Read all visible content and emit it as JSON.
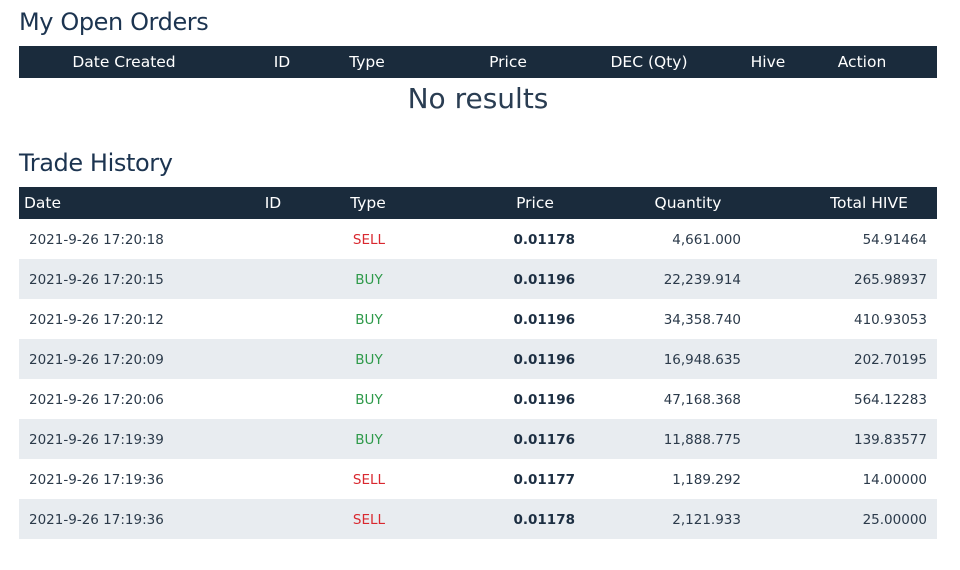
{
  "open_orders": {
    "title": "My Open Orders",
    "columns": [
      "Date Created",
      "ID",
      "Type",
      "Price",
      "DEC (Qty)",
      "Hive",
      "Action"
    ],
    "empty_message": "No results"
  },
  "trade_history": {
    "title": "Trade History",
    "columns": [
      "Date",
      "ID",
      "Type",
      "Price",
      "Quantity",
      "Total HIVE"
    ],
    "rows": [
      {
        "date": "2021-9-26 17:20:18",
        "type": "SELL",
        "price": "0.01178",
        "quantity": "4,661.000",
        "total": "54.91464"
      },
      {
        "date": "2021-9-26 17:20:15",
        "type": "BUY",
        "price": "0.01196",
        "quantity": "22,239.914",
        "total": "265.98937"
      },
      {
        "date": "2021-9-26 17:20:12",
        "type": "BUY",
        "price": "0.01196",
        "quantity": "34,358.740",
        "total": "410.93053"
      },
      {
        "date": "2021-9-26 17:20:09",
        "type": "BUY",
        "price": "0.01196",
        "quantity": "16,948.635",
        "total": "202.70195"
      },
      {
        "date": "2021-9-26 17:20:06",
        "type": "BUY",
        "price": "0.01196",
        "quantity": "47,168.368",
        "total": "564.12283"
      },
      {
        "date": "2021-9-26 17:19:39",
        "type": "BUY",
        "price": "0.01176",
        "quantity": "11,888.775",
        "total": "139.83577"
      },
      {
        "date": "2021-9-26 17:19:36",
        "type": "SELL",
        "price": "0.01177",
        "quantity": "1,189.292",
        "total": "14.00000"
      },
      {
        "date": "2021-9-26 17:19:36",
        "type": "SELL",
        "price": "0.01178",
        "quantity": "2,121.933",
        "total": "25.00000"
      }
    ]
  },
  "colors": {
    "header_bg": "#1a2b3c",
    "sell": "#d9282f",
    "buy": "#2e9a4a",
    "stripe": "#e8ecf0"
  }
}
